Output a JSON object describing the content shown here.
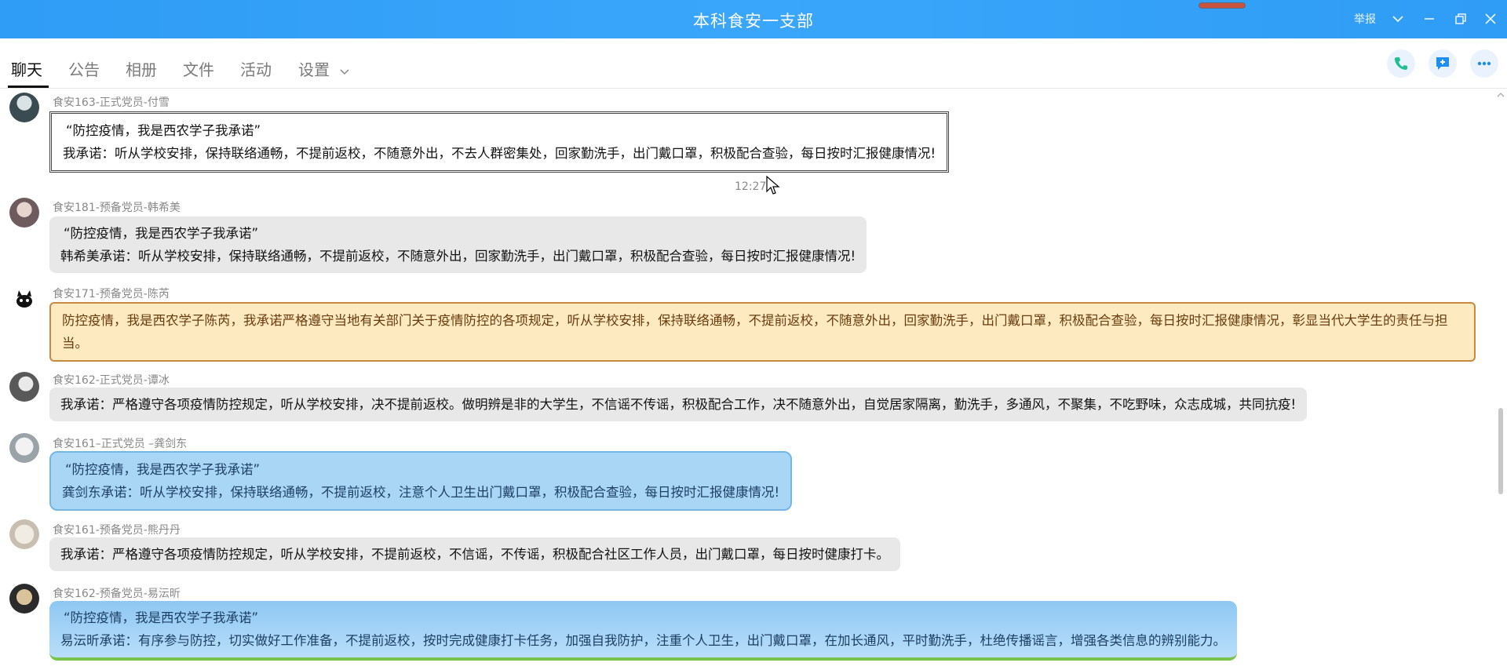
{
  "window": {
    "title": "本科食安一支部",
    "report_label": "举报",
    "icons": [
      "chevron-down-icon",
      "minimize-icon",
      "restore-icon",
      "close-icon"
    ]
  },
  "tabs": [
    {
      "label": "聊天",
      "active": true
    },
    {
      "label": "公告",
      "active": false
    },
    {
      "label": "相册",
      "active": false
    },
    {
      "label": "文件",
      "active": false
    },
    {
      "label": "活动",
      "active": false
    },
    {
      "label": "设置",
      "active": false
    }
  ],
  "toolbar_icons": [
    "phone-icon",
    "add-chat-icon",
    "more-icon"
  ],
  "colors": {
    "accent": "#3aa6fb",
    "phone": "#1fbf8f"
  },
  "messages": [
    {
      "sender": "食安163-正式党员-付雪",
      "quote": "“防控疫情，我是西农学子我承诺”",
      "text": "我承诺：听从学校安排，保持联络通畅，不提前返校，不随意外出，不去人群密集处，回家勤洗手，出门戴口罩，积极配合查验，每日按时汇报健康情况!"
    },
    {
      "timestamp": "12:27"
    },
    {
      "sender": "食安181-预备党员-韩希美",
      "quote": "“防控疫情，我是西农学子我承诺”",
      "text": "韩希美承诺：听从学校安排，保持联络通畅，不提前返校，不随意外出，回家勤洗手，出门戴口罩，积极配合查验，每日按时汇报健康情况!"
    },
    {
      "sender": "食安171-预备党员-陈芮",
      "text": "防控疫情，我是西农学子陈芮，我承诺严格遵守当地有关部门关于疫情防控的各项规定，听从学校安排，保持联络通畅，不提前返校，不随意外出，回家勤洗手，出门戴口罩，积极配合查验，每日按时汇报健康情况，彰显当代大学生的责任与担当。"
    },
    {
      "sender": "食安162-正式党员-谭冰",
      "text": "我承诺：严格遵守各项疫情防控规定，听从学校安排，决不提前返校。做明辨是非的大学生，不信谣不传谣，积极配合工作，决不随意外出，自觉居家隔离，勤洗手，多通风，不聚集，不吃野味，众志成城，共同抗疫!"
    },
    {
      "sender": "食安161–正式党员 –龚剑东",
      "quote": "“防控疫情，我是西农学子我承诺”",
      "text": "龚剑东承诺：听从学校安排，保持联络通畅，不提前返校，注意个人卫生出门戴口罩，积极配合查验，每日按时汇报健康情况!"
    },
    {
      "sender": "食安161-预备党员-熊丹丹",
      "text": "我承诺：严格遵守各项疫情防控规定，听从学校安排，不提前返校，不信谣，不传谣，积极配合社区工作人员，出门戴口罩，每日按时健康打卡。"
    },
    {
      "sender": "食安162-预备党员-易沄昕",
      "quote": "“防控疫情，我是西农学子我承诺”",
      "text": "易沄昕承诺：有序参与防控，切实做好工作准备，不提前返校，按时完成健康打卡任务，加强自我防护，注重个人卫生，出门戴口罩，在加长通风，平时勤洗手，杜绝传播谣言，增强各类信息的辨别能力。"
    }
  ]
}
